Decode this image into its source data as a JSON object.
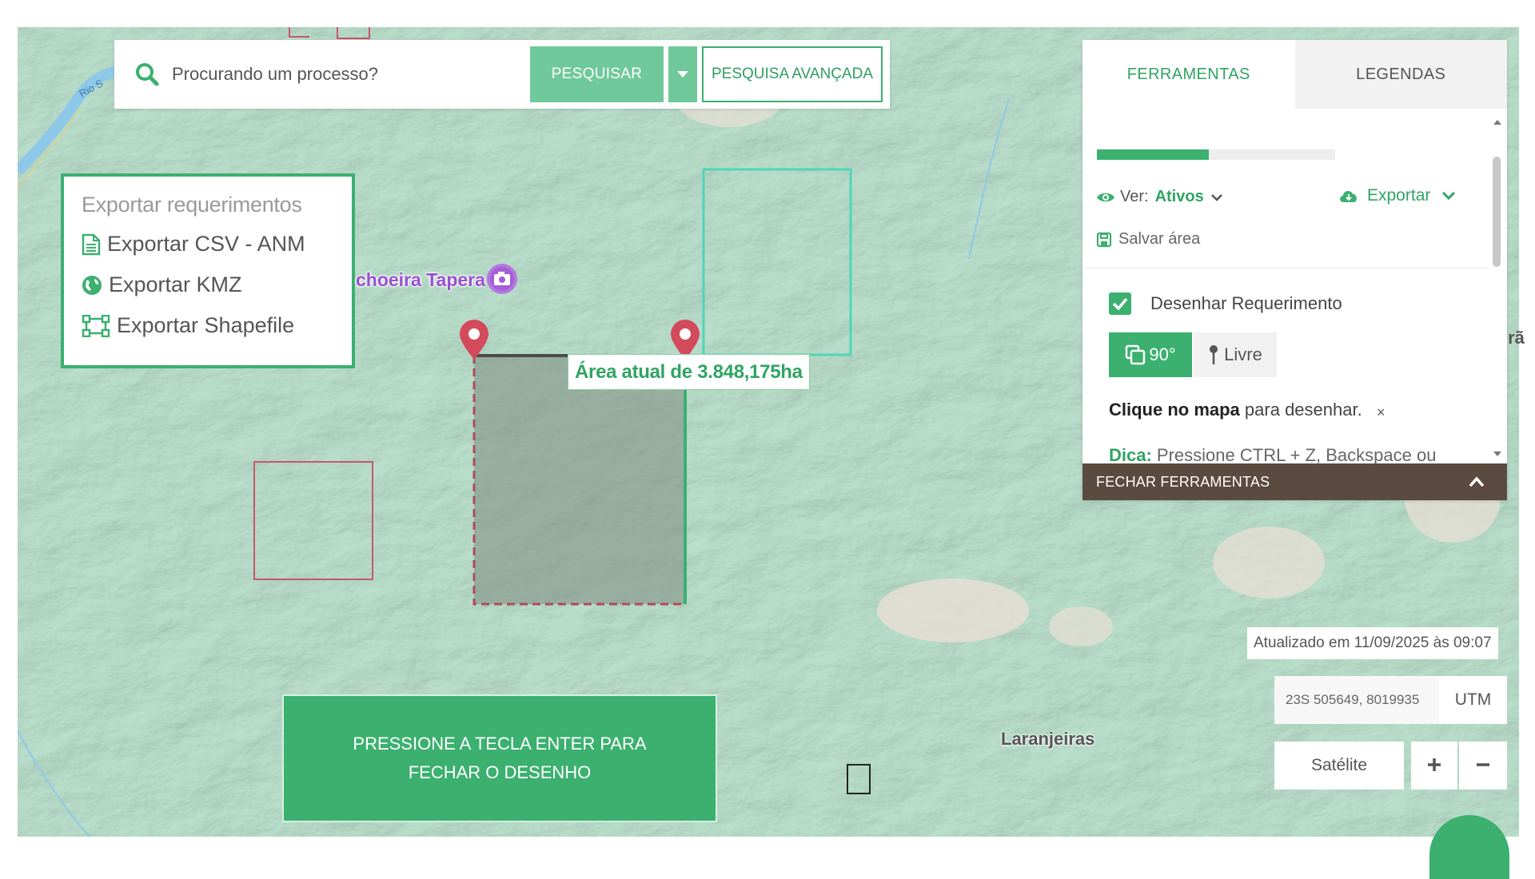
{
  "search": {
    "placeholder": "Procurando um processo?",
    "search_label": "PESQUISAR",
    "advanced_label": "PESQUISA AVANÇADA"
  },
  "export_menu": {
    "title": "Exportar requerimentos",
    "items": [
      {
        "label": "Exportar CSV - ANM",
        "icon": "file-icon"
      },
      {
        "label": "Exportar KMZ",
        "icon": "globe-icon"
      },
      {
        "label": "Exportar Shapefile",
        "icon": "shape-icon"
      }
    ]
  },
  "map": {
    "place_label": "choeira Tapera",
    "town_label": "Laranjeiras",
    "river_label": "Rio S",
    "edge_label": "irã",
    "area_label": "Área atual de 3.848,175ha"
  },
  "draw_banner": {
    "text": "PRESSIONE A TECLA ENTER PARA FECHAR O DESENHO"
  },
  "tools": {
    "tabs": [
      "FERRAMENTAS",
      "LEGENDAS"
    ],
    "active_tab": "FERRAMENTAS",
    "ver_label": "Ver:",
    "ver_value": "Ativos",
    "export_label": "Exportar",
    "save_label": "Salvar área",
    "draw_label": "Desenhar Requerimento",
    "draw_checked": true,
    "mode_90": "90°",
    "mode_free": "Livre",
    "hint_bold": "Clique no mapa",
    "hint_rest": "para desenhar.",
    "hint_close": "×",
    "tip_bold": "Dica:",
    "tip_text": "Pressione CTRL + Z, Backspace ou Delete para desfazer o último clique.",
    "close_label": "FECHAR FERRAMENTAS",
    "progress_fraction": 0.47
  },
  "status": {
    "updated": "Atualizado em 11/09/2025 às 09:07",
    "coords": "23S 505649, 8019935",
    "coords_unit": "UTM",
    "satellite_label": "Satélite"
  },
  "colors": {
    "accent": "#3bb06f",
    "map_bg": "#bde3cf",
    "close_bar": "#5b4a40",
    "draw_fill": "#7d8a80"
  }
}
